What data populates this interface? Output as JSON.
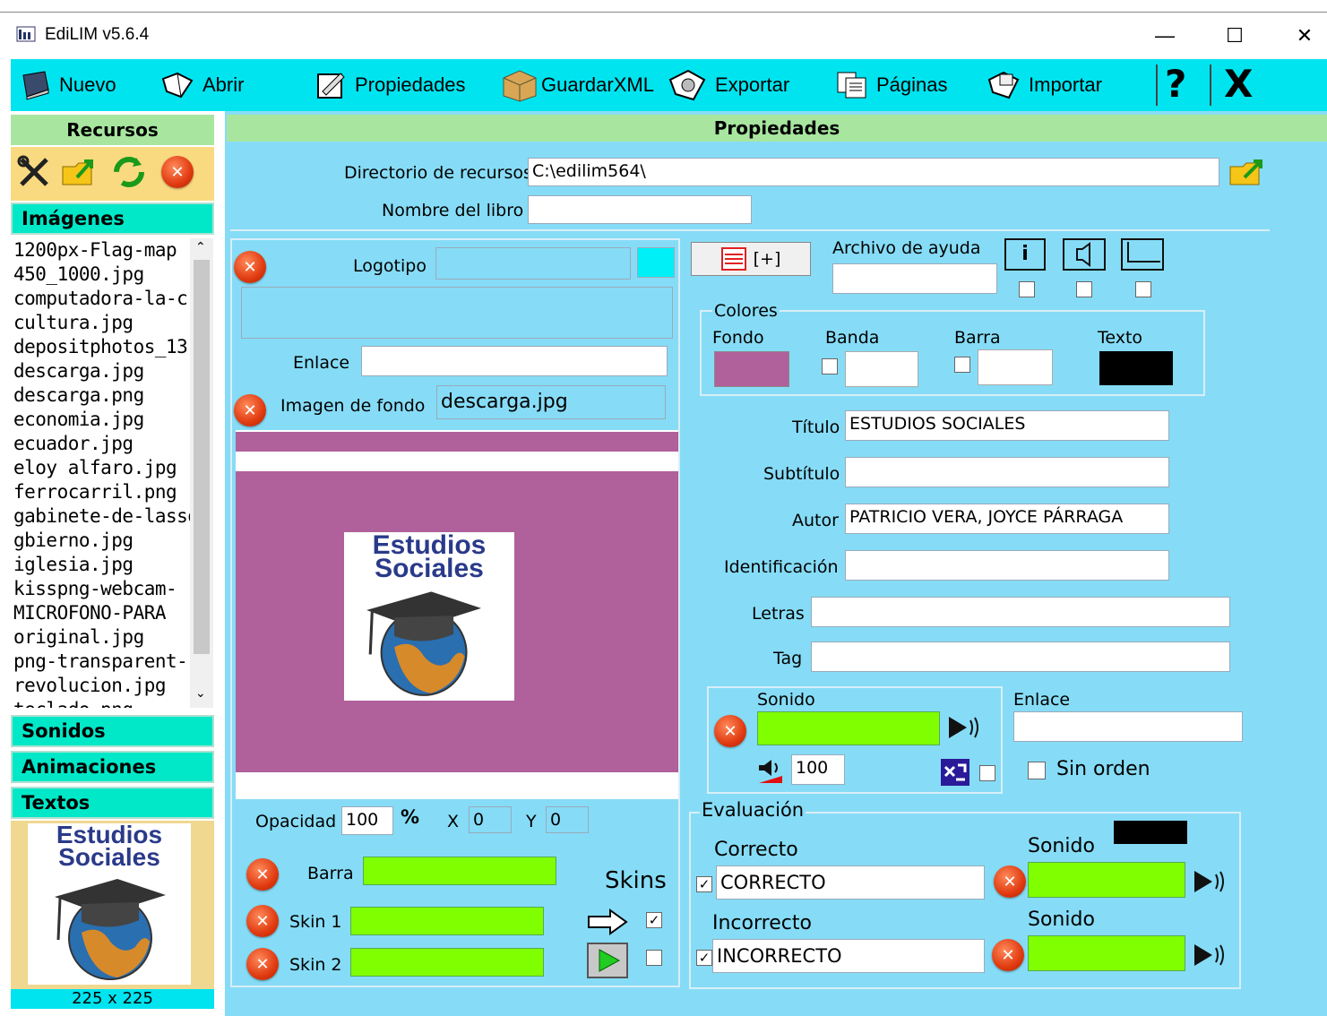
{
  "window": {
    "title": "EdiLIM  v5.6.4",
    "minimize": "—",
    "maximize": "☐",
    "close": "✕"
  },
  "toolbar": {
    "nuevo": "Nuevo",
    "abrir": "Abrir",
    "propiedades": "Propiedades",
    "guardar": "GuardarXML",
    "exportar": "Exportar",
    "paginas": "Páginas",
    "importar": "Importar",
    "help": "?",
    "exit": "X"
  },
  "sidebar": {
    "recursos_title": "Recursos",
    "imagenes_title": "Imágenes",
    "files": [
      "1200px-Flag-map",
      "450_1000.jpg",
      "computadora-la-c",
      "cultura.jpg",
      "depositphotos_13",
      "descarga.jpg",
      "descarga.png",
      "economia.jpg",
      "ecuador.jpg",
      "eloy alfaro.jpg",
      "ferrocarril.png",
      "gabinete-de-lasso",
      "gbierno.jpg",
      "iglesia.jpg",
      "kisspng-webcam-",
      "MICROFONO-PARA",
      "original.jpg",
      "png-transparent-",
      "revolucion.jpg",
      "teclado.png"
    ],
    "sonidos": "Sonidos",
    "animaciones": "Animaciones",
    "textos": "Textos",
    "preview_size": "225 x 225"
  },
  "logo_text": {
    "line1": "Estudios",
    "line2": "Sociales"
  },
  "main": {
    "title": "Propiedades",
    "dir_label": "Directorio de recursos",
    "dir_value": "C:\\edilim564\\",
    "book_label": "Nombre del libro",
    "book_value": "",
    "logo_label": "Logotipo",
    "enlace_label": "Enlace",
    "fondo_img_label": "Imagen de fondo",
    "fondo_img_value": "descarga.jpg",
    "help_file_label": "Archivo de ayuda",
    "add_btn": "[+]",
    "colores_label": "Colores",
    "fondo_label": "Fondo",
    "banda_label": "Banda",
    "barra_label": "Barra",
    "texto_label": "Texto",
    "titulo_label": "Título",
    "titulo_value": "ESTUDIOS SOCIALES",
    "subtitulo_label": "Subtítulo",
    "autor_label": "Autor",
    "autor_value": "PATRICIO VERA, JOYCE PÁRRAGA",
    "ident_label": "Identificación",
    "letras_label": "Letras",
    "tag_label": "Tag",
    "sonido_label": "Sonido",
    "enlace2_label": "Enlace",
    "volume_value": "100",
    "sin_orden_label": "Sin orden",
    "opacidad_label": "Opacidad",
    "opacidad_value": "100",
    "percent": "%",
    "x_label": "X",
    "x_value": "0",
    "y_label": "Y",
    "y_value": "0",
    "barra2_label": "Barra",
    "skins_label": "Skins",
    "skin1_label": "Skin 1",
    "skin2_label": "Skin 2",
    "evaluacion_label": "Evaluación",
    "correcto_label": "Correcto",
    "correcto_value": "CORRECTO",
    "incorrecto_label": "Incorrecto",
    "incorrecto_value": "INCORRECTO",
    "sonido_c_label": "Sonido",
    "sonido_i_label": "Sonido",
    "help_icon_i": "i"
  },
  "colors": {
    "fondo": "#b0609a",
    "texto": "#000000",
    "toolbar": "#00e4f0",
    "panel": "#86dcf6",
    "green": "#80ff00"
  }
}
